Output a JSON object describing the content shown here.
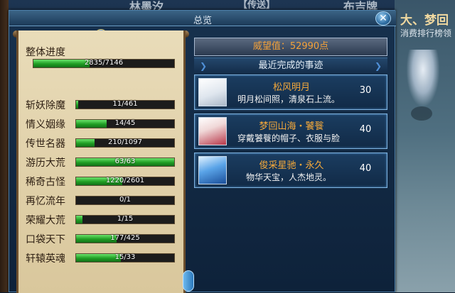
{
  "background": {
    "signs": [
      "林墨汐",
      "【传送】",
      "布吉牌"
    ],
    "right_sign_a": "大、梦回",
    "right_sign_b": "消费排行榜领"
  },
  "window": {
    "title": "总览",
    "close_label": "✕"
  },
  "progress": [
    {
      "label": "整体进度",
      "text": "2835/7146",
      "fraction": 0.3967
    },
    {
      "label": "斩妖除魔",
      "text": "11/461",
      "fraction": 0.0239
    },
    {
      "label": "情义姻缘",
      "text": "14/45",
      "fraction": 0.3111
    },
    {
      "label": "传世名器",
      "text": "210/1097",
      "fraction": 0.1914
    },
    {
      "label": "游历大荒",
      "text": "63/63",
      "fraction": 1.0
    },
    {
      "label": "稀奇古怪",
      "text": "1220/2601",
      "fraction": 0.469
    },
    {
      "label": "再忆流年",
      "text": "0/1",
      "fraction": 0.0
    },
    {
      "label": "荣耀大荒",
      "text": "1/15",
      "fraction": 0.0667
    },
    {
      "label": "口袋天下",
      "text": "177/425",
      "fraction": 0.4165
    },
    {
      "label": "轩辕英魂",
      "text": "15/33",
      "fraction": 0.4545
    }
  ],
  "prestige": "威望值：52990点",
  "recent": {
    "header": "最近完成的事迹",
    "items": [
      {
        "name": "松风明月",
        "desc": "明月松间照，清泉石上流。",
        "points": "30",
        "icon": "white-robe-icon"
      },
      {
        "name": "梦回山海・饕餮",
        "desc": "穿戴饕餮的帽子、衣服与脸",
        "points": "40",
        "icon": "red-white-mask-icon"
      },
      {
        "name": "俊采星驰・永久",
        "desc": "物华天宝，人杰地灵。",
        "points": "40",
        "icon": "blue-robe-icon"
      }
    ]
  },
  "colors": {
    "accent_gold": "#f5a93a",
    "bar_green": "#1f9e24",
    "panel_blue": "#1b3d61"
  }
}
